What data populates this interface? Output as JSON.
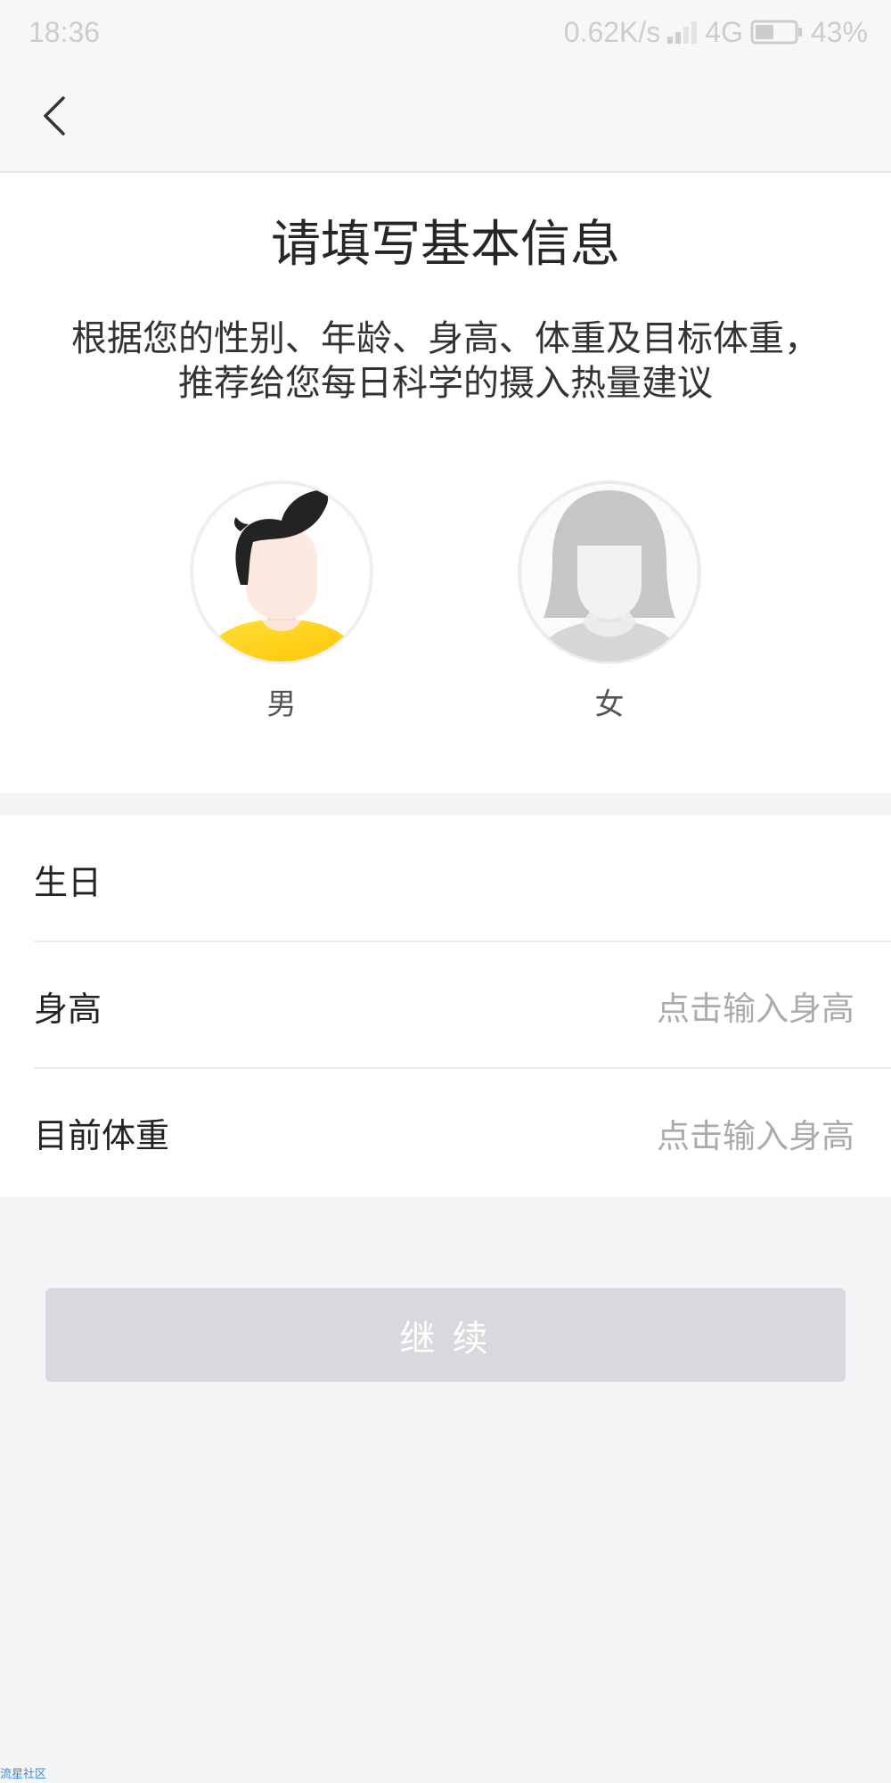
{
  "status_bar": {
    "time": "18:36",
    "network_speed": "0.62K/s",
    "network_type": "4G",
    "battery": "43%",
    "icons": {
      "signal": "signal-icon",
      "battery": "battery-icon"
    }
  },
  "nav": {
    "back_icon": "chevron-left-icon"
  },
  "header": {
    "title": "请填写基本信息",
    "subtitle_line1": "根据您的性别、年龄、身高、体重及目标体重，",
    "subtitle_line2": "推荐给您每日科学的摄入热量建议"
  },
  "gender": {
    "options": [
      {
        "label": "男",
        "icon": "male-avatar-icon"
      },
      {
        "label": "女",
        "icon": "female-avatar-icon"
      }
    ]
  },
  "form": {
    "rows": [
      {
        "label": "生日"
      },
      {
        "label": "身高",
        "placeholder": "点击输入身高"
      },
      {
        "label": "目前体重",
        "placeholder": "点击输入身高"
      }
    ]
  },
  "continue_button": {
    "label": "继 续"
  },
  "watermark": "流星社区",
  "colors": {
    "page_background": "#f4f5f7",
    "male_shirt": "#ffd21f",
    "button_disabled": "#d8d9dc",
    "placeholder": "#ababab"
  }
}
